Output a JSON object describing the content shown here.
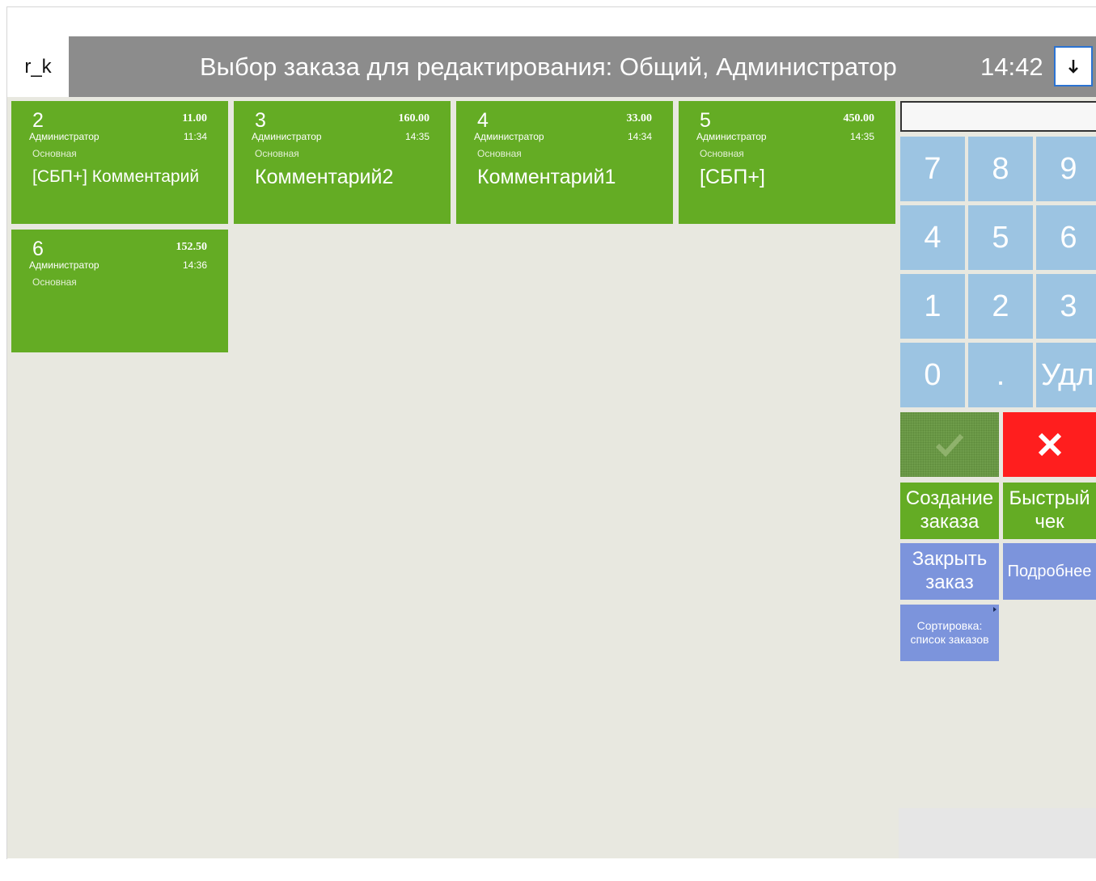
{
  "app": {
    "logo": "r_k",
    "title": "Выбор заказа для редактирования: Общий, Администратор",
    "clock": "14:42"
  },
  "orders": [
    {
      "number": "2",
      "sum": "11.00",
      "user": "Администратор",
      "time": "11:34",
      "hall": "Основная",
      "comment": "[СБП+] Комментарий"
    },
    {
      "number": "3",
      "sum": "160.00",
      "user": "Администратор",
      "time": "14:35",
      "hall": "Основная",
      "comment": "Комментарий2"
    },
    {
      "number": "4",
      "sum": "33.00",
      "user": "Администратор",
      "time": "14:34",
      "hall": "Основная",
      "comment": "Комментарий1"
    },
    {
      "number": "5",
      "sum": "450.00",
      "user": "Администратор",
      "time": "14:35",
      "hall": "Основная",
      "comment": "[СБП+]"
    },
    {
      "number": "6",
      "sum": "152.50",
      "user": "Администратор",
      "time": "14:36",
      "hall": "Основная",
      "comment": ""
    }
  ],
  "numpad": {
    "input_value": "",
    "keys": [
      "7",
      "8",
      "9",
      "4",
      "5",
      "6",
      "1",
      "2",
      "3",
      "0",
      ".",
      "Удл"
    ]
  },
  "actions": {
    "create_order_line1": "Создание",
    "create_order_line2": "заказа",
    "quick_check_line1": "Быстрый",
    "quick_check_line2": "чек",
    "close_order_line1": "Закрыть",
    "close_order_line2": "заказ",
    "details": "Подробнее",
    "sort_line1": "Сортировка:",
    "sort_line2": "список заказов"
  },
  "colors": {
    "order_tile": "#64ac24",
    "keypad": "#9cc4e2",
    "cancel": "#ff1e1e",
    "blue_action": "#7c94dc",
    "titlebar": "#8c8c8c"
  }
}
